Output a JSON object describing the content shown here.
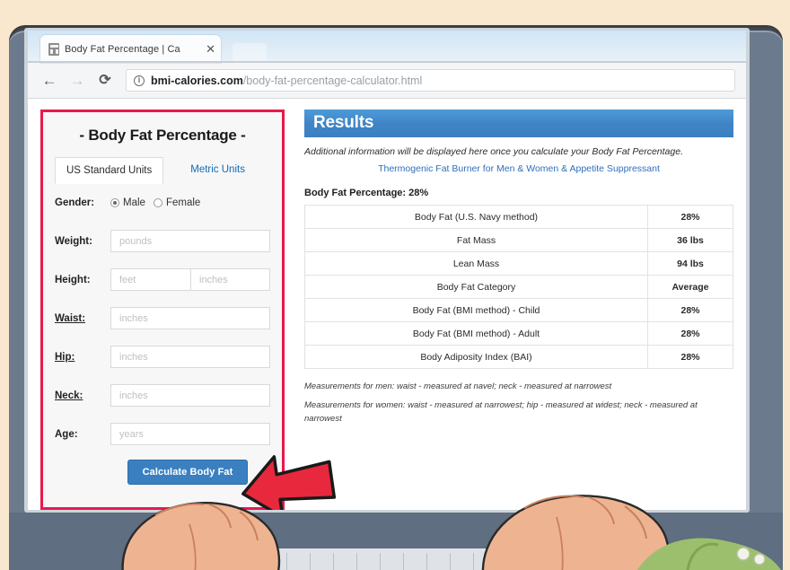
{
  "browser": {
    "tab": {
      "title": "Body Fat Percentage | Ca",
      "favicon": "calculator-icon",
      "close_label": "✕"
    },
    "toolbar": {
      "back_label": "←",
      "forward_label": "→",
      "reload_label": "⟳",
      "site_info_label": "i",
      "url_host": "bmi-calories.com",
      "url_path": "/body-fat-percentage-calculator.html"
    }
  },
  "calculator": {
    "title": "- Body Fat Percentage -",
    "unit_tabs": [
      {
        "label": "US Standard Units",
        "active": true
      },
      {
        "label": "Metric Units",
        "active": false
      }
    ],
    "gender": {
      "label": "Gender:",
      "options": [
        {
          "label": "Male",
          "checked": true
        },
        {
          "label": "Female",
          "checked": false
        }
      ]
    },
    "fields": [
      {
        "label": "Weight:",
        "placeholder": "pounds"
      },
      {
        "label": "Height:",
        "placeholder": "feet",
        "placeholder2": "inches"
      },
      {
        "label": "Waist:",
        "placeholder": "inches"
      },
      {
        "label": "Hip:",
        "placeholder": "inches"
      },
      {
        "label": "Neck:",
        "placeholder": "inches"
      },
      {
        "label": "Age:",
        "placeholder": "years"
      }
    ],
    "submit_label": "Calculate Body Fat",
    "highlight_color": "#e8194b",
    "button_color": "#3a80c1"
  },
  "results": {
    "header": "Results",
    "note": "Additional information will be displayed here once you calculate your Body Fat Percentage.",
    "ad_link": "Thermogenic Fat Burner for Men & Women & Appetite Suppressant",
    "summary": "Body Fat Percentage: 28%",
    "rows": [
      {
        "label": "Body Fat (U.S. Navy method)",
        "value": "28%"
      },
      {
        "label": "Fat Mass",
        "value": "36 lbs"
      },
      {
        "label": "Lean Mass",
        "value": "94 lbs"
      },
      {
        "label": "Body Fat Category",
        "value": "Average"
      },
      {
        "label": "Body Fat (BMI method) - Child",
        "value": "28%"
      },
      {
        "label": "Body Fat (BMI method) - Adult",
        "value": "28%"
      },
      {
        "label": "Body Adiposity Index (BAI)",
        "value": "28%"
      }
    ],
    "footnotes": [
      "Measurements for men: waist - measured at navel; neck - measured at narrowest",
      "Measurements for women: waist - measured at narrowest; hip - measured at widest; neck - measured at narrowest"
    ],
    "header_color": "#3f85c6"
  },
  "annotation": {
    "arrow": "red-arrow-pointing-to-calculate-button"
  },
  "scene": {
    "background_color": "#fae8ce",
    "laptop_color": "#6b7a8c",
    "skin_color": "#e8b38f"
  }
}
